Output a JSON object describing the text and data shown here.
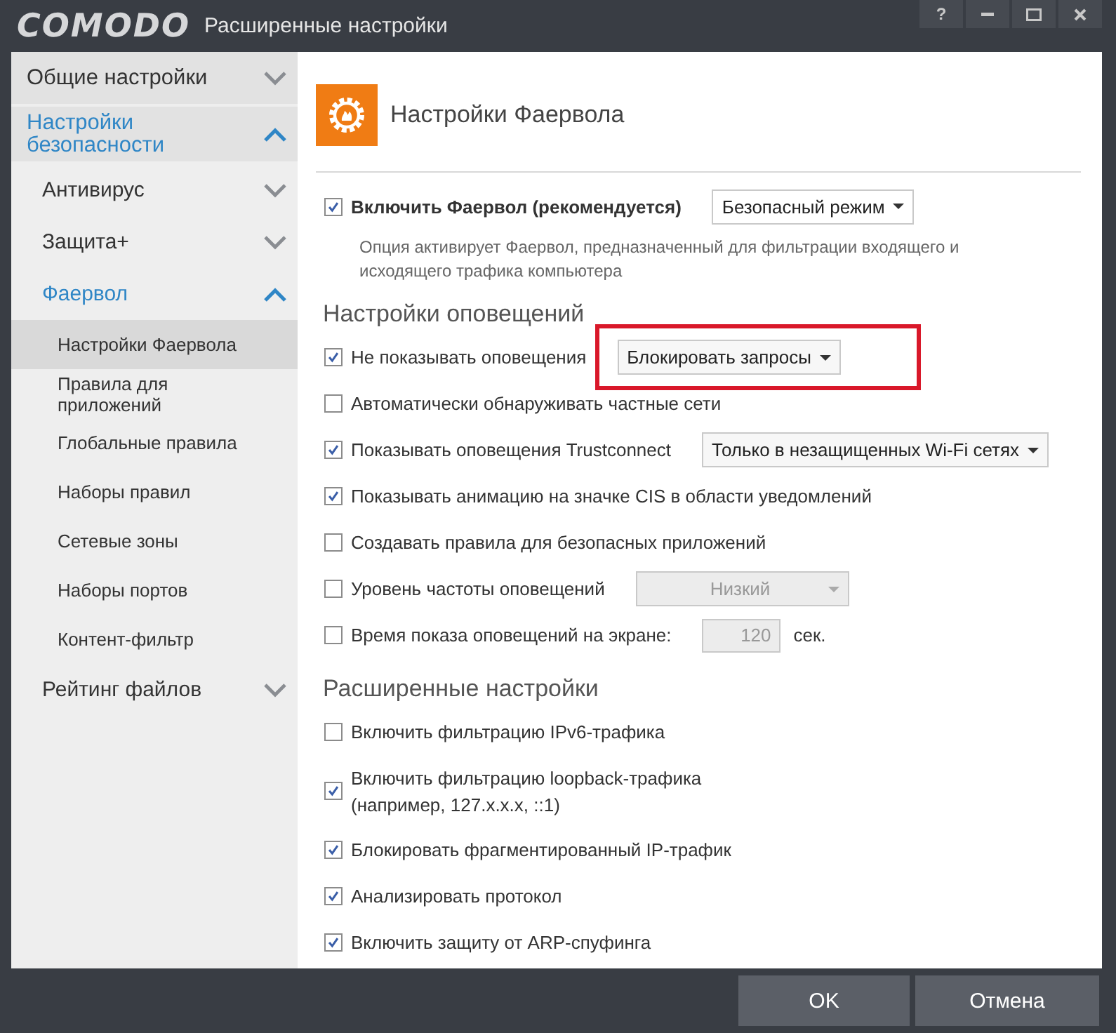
{
  "window": {
    "logo": "COMODO",
    "title": "Расширенные настройки",
    "help": "?"
  },
  "sidebar": {
    "items": [
      {
        "label": "Общие настройки",
        "expanded": false
      },
      {
        "label": "Настройки безопасности",
        "expanded": true,
        "children": [
          {
            "label": "Антивирус",
            "expanded": false
          },
          {
            "label": "Защита+",
            "expanded": false
          },
          {
            "label": "Фаервол",
            "expanded": true,
            "children": [
              {
                "label": "Настройки Фаервола",
                "selected": true
              },
              {
                "label": "Правила для приложений",
                "selected": false
              },
              {
                "label": "Глобальные правила",
                "selected": false
              },
              {
                "label": "Наборы правил",
                "selected": false
              },
              {
                "label": "Сетевые зоны",
                "selected": false
              },
              {
                "label": "Наборы портов",
                "selected": false
              },
              {
                "label": "Контент-фильтр",
                "selected": false
              }
            ]
          },
          {
            "label": "Рейтинг файлов",
            "expanded": false
          }
        ]
      }
    ]
  },
  "panel": {
    "title": "Настройки Фаервола",
    "main_option": {
      "label": "Включить Фаервол (рекомендуется)",
      "checked": true,
      "dropdown": "Безопасный режим",
      "description": "Опция активирует Фаервол, предназначенный для фильтрации входящего и исходящего трафика компьютера"
    },
    "sections": [
      {
        "title": "Настройки оповещений",
        "rows": [
          {
            "label": "Не показывать оповещения",
            "checked": true,
            "kind": "dropdown",
            "value": "Блокировать запросы",
            "disabled": false,
            "highlighted": true
          },
          {
            "label": "Автоматически обнаруживать частные сети",
            "checked": false,
            "kind": "plain"
          },
          {
            "label": "Показывать оповещения Trustconnect",
            "checked": true,
            "kind": "dropdown",
            "value": "Только в незащищенных Wi-Fi сетях",
            "disabled": false,
            "highlighted": false
          },
          {
            "label": "Показывать анимацию на значке CIS в области уведомлений",
            "checked": true,
            "kind": "plain"
          },
          {
            "label": "Создавать правила для безопасных приложений",
            "checked": false,
            "kind": "plain"
          },
          {
            "label": "Уровень частоты оповещений",
            "checked": false,
            "kind": "dropdown",
            "value": "Низкий",
            "disabled": true,
            "highlighted": false
          },
          {
            "label": "Время показа оповещений на экране:",
            "checked": false,
            "kind": "number",
            "value": "120",
            "unit": "сек.",
            "disabled": true
          }
        ]
      },
      {
        "title": "Расширенные настройки",
        "rows": [
          {
            "label": "Включить фильтрацию IPv6-трафика",
            "checked": false,
            "kind": "plain"
          },
          {
            "label": "Включить фильтрацию loopback-трафика (например, 127.x.x.x, ::1)",
            "checked": true,
            "kind": "wrapped"
          },
          {
            "label": "Блокировать фрагментированный IP-трафик",
            "checked": true,
            "kind": "plain"
          },
          {
            "label": "Анализировать протокол",
            "checked": true,
            "kind": "plain"
          },
          {
            "label": "Включить защиту от ARP-спуфинга",
            "checked": true,
            "kind": "plain"
          }
        ]
      }
    ]
  },
  "buttons": [
    "OK",
    "Отмена"
  ]
}
